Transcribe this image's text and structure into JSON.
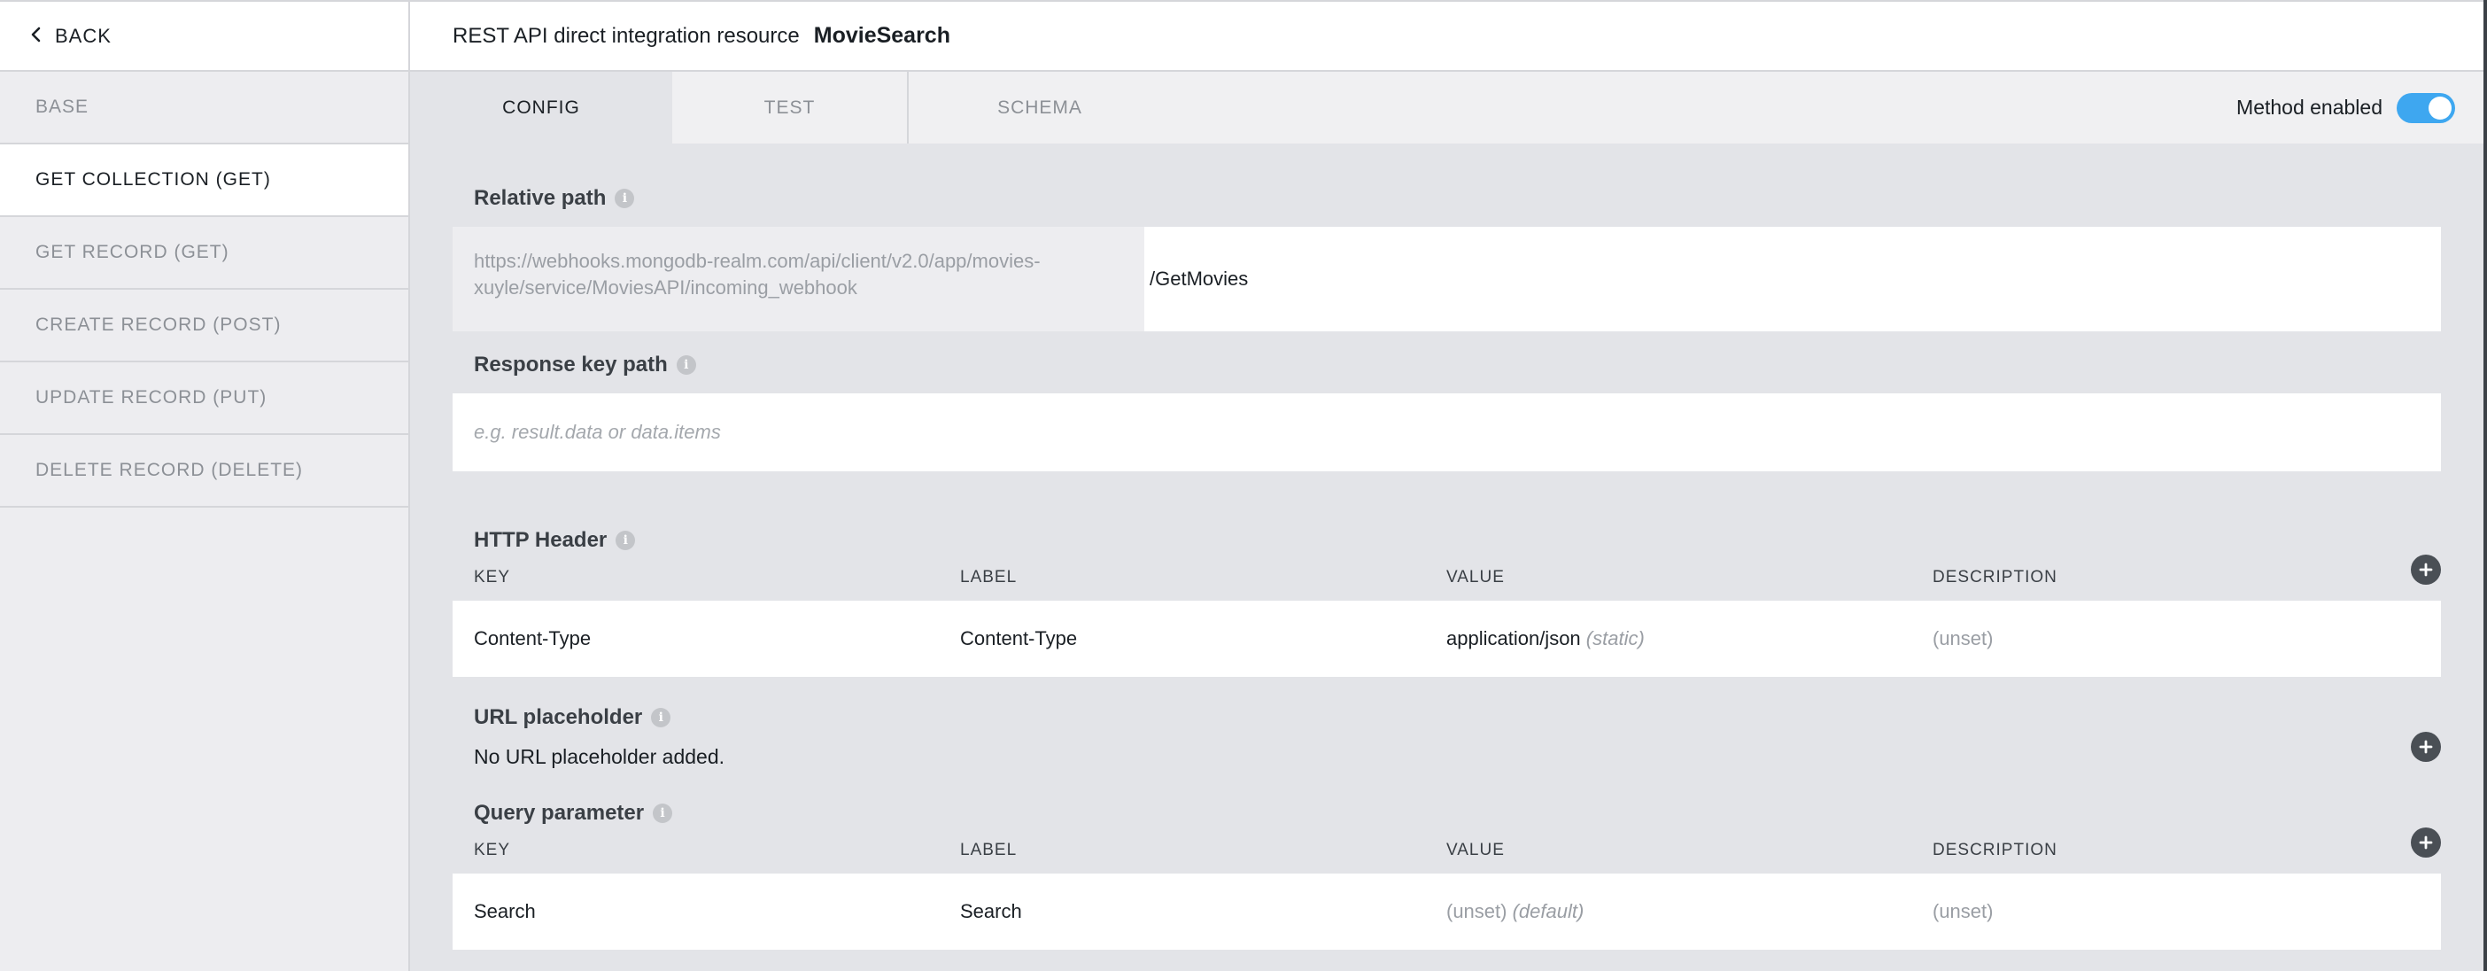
{
  "sidebar": {
    "back_label": "BACK",
    "items": [
      {
        "label": "BASE",
        "active": false
      },
      {
        "label": "GET COLLECTION (GET)",
        "active": true
      },
      {
        "label": "GET RECORD (GET)",
        "active": false
      },
      {
        "label": "CREATE RECORD (POST)",
        "active": false
      },
      {
        "label": "UPDATE RECORD (PUT)",
        "active": false
      },
      {
        "label": "DELETE RECORD (DELETE)",
        "active": false
      }
    ]
  },
  "header": {
    "prefix": "REST API direct integration resource",
    "name": "MovieSearch"
  },
  "tabs": [
    {
      "label": "CONFIG",
      "active": true
    },
    {
      "label": "TEST",
      "active": false
    },
    {
      "label": "SCHEMA",
      "active": false
    }
  ],
  "method_toggle": {
    "label": "Method enabled",
    "enabled": true
  },
  "relative_path": {
    "label": "Relative path",
    "base_url": "https://webhooks.mongodb-realm.com/api/client/v2.0/app/movies-xuyle/service/MoviesAPI/incoming_webhook",
    "value": "/GetMovies"
  },
  "response_key_path": {
    "label": "Response key path",
    "placeholder": "e.g. result.data or data.items"
  },
  "http_header": {
    "label": "HTTP Header",
    "columns": [
      "KEY",
      "LABEL",
      "VALUE",
      "DESCRIPTION"
    ],
    "rows": [
      {
        "key": "Content-Type",
        "label": "Content-Type",
        "value": "application/json",
        "value_note": "(static)",
        "description": "(unset)"
      }
    ]
  },
  "url_placeholder": {
    "label": "URL placeholder",
    "empty_text": "No URL placeholder added."
  },
  "query_parameter": {
    "label": "Query parameter",
    "columns": [
      "KEY",
      "LABEL",
      "VALUE",
      "DESCRIPTION"
    ],
    "rows": [
      {
        "key": "Search",
        "label": "Search",
        "value": "(unset)",
        "value_note": "(default)",
        "description": "(unset)"
      }
    ]
  },
  "colors": {
    "accent": "#3ea7f0",
    "sidebar_bg": "#ededf0",
    "main_bg": "#e3e4e8"
  }
}
